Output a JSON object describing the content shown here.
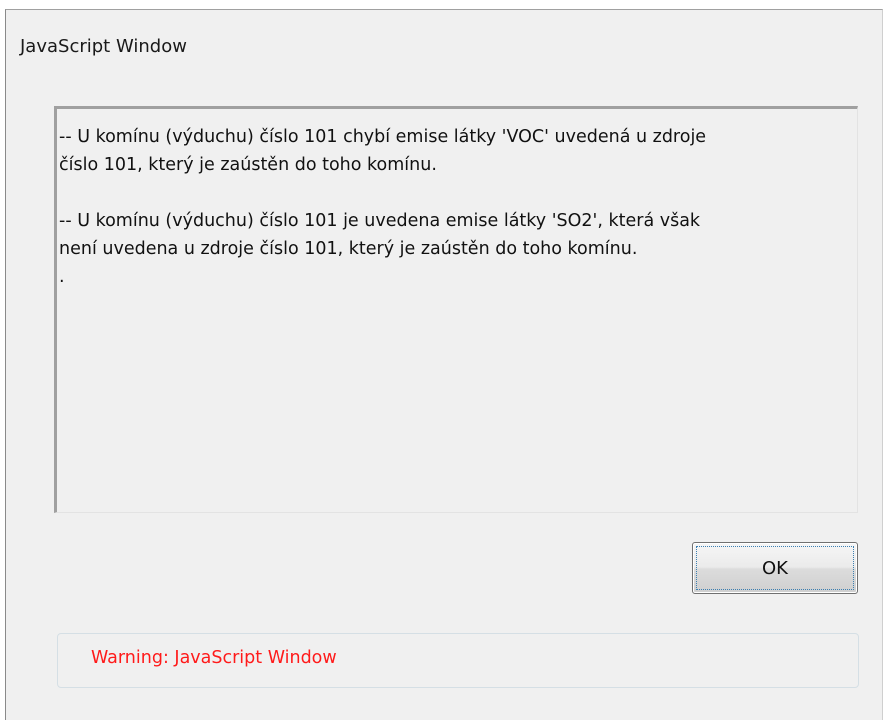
{
  "window": {
    "title": "JavaScript Window"
  },
  "message": {
    "paragraph1": {
      "line1": "-- U komínu (výduchu) číslo 101 chybí emise látky 'VOC' uvedená u zdroje",
      "line2": "číslo 101, který je zaústěn do toho komínu."
    },
    "paragraph2": {
      "line1": "-- U komínu (výduchu) číslo 101 je uvedena emise látky 'SO2', která však",
      "line2": "není uvedena u zdroje číslo 101, který je zaústěn do toho komínu."
    },
    "trailing": "."
  },
  "buttons": {
    "ok_label": "OK"
  },
  "status": {
    "warning": "Warning: JavaScript Window",
    "warning_color": "#ff1a1a"
  }
}
